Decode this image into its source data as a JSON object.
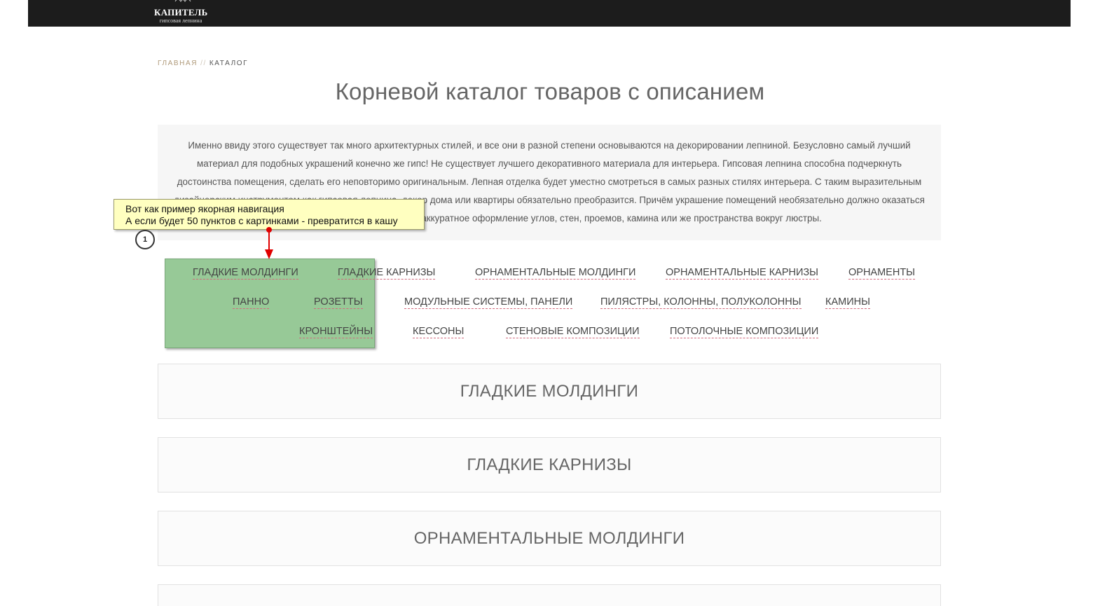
{
  "header": {
    "logo_name": "КАПИТЕЛЬ",
    "logo_subtitle": "гипсовая лепнина"
  },
  "breadcrumb": {
    "home": "ГЛАВНАЯ",
    "separator": "//",
    "current": "КАТАЛОГ"
  },
  "page_title": "Корневой каталог товаров с описанием",
  "intro_text": "Именно ввиду этого существует так много архитектурных стилей, и все они в разной степени основываются на декорировании лепниной. Безусловно самый лучший материал для подобных украшений конечно же гипс! Не существует лучшего декоративного материала для интерьера. Гипсовая лепнина способна подчеркнуть достоинства помещения, сделать его неповторимо оригинальным. Лепная отделка будет уместно смотреться в самых разных стилях интерьера. С таким выразительным дизайнерским инструментом как гипсовая лепнина, декор дома или квартиры обязательно преобразится. Причём украшение помещений необязательно должно оказаться перегруженным: это может быть аккуратное оформление углов, стен, проемов, камина или же пространства вокруг люстры.",
  "anchor_nav": [
    "ГЛАДКИЕ МОЛДИНГИ",
    "ГЛАДКИЕ КАРНИЗЫ",
    "ОРНАМЕНТАЛЬНЫЕ МОЛДИНГИ",
    "ОРНАМЕНТАЛЬНЫЕ КАРНИЗЫ",
    "ОРНАМЕНТЫ",
    "ПАННО",
    "РОЗЕТТЫ",
    "МОДУЛЬНЫЕ СИСТЕМЫ, ПАНЕЛИ",
    "ПИЛЯСТРЫ, КОЛОННЫ, ПОЛУКОЛОННЫ",
    "КАМИНЫ",
    "КРОНШТЕЙНЫ",
    "КЕССОНЫ",
    "СТЕНОВЫЕ КОМПОЗИЦИИ",
    "ПОТОЛОЧНЫЕ КОМПОЗИЦИИ"
  ],
  "annotation": {
    "line1": "Вот как пример якорная навигация",
    "line2": "А если будет 50 пунктов с картинками - превратится в кашу",
    "badge": "1"
  },
  "sections": [
    "ГЛАДКИЕ МОЛДИНГИ",
    "ГЛАДКИЕ КАРНИЗЫ",
    "ОРНАМЕНТАЛЬНЫЕ МОЛДИНГИ",
    ""
  ],
  "colors": {
    "topbar": "#1c1c1c",
    "breadcrumb_home": "#b09a7a",
    "nav_underline": "#d26a7d",
    "highlight": "#97c997",
    "callout": "#ffffc0",
    "arrow": "#e00000"
  }
}
